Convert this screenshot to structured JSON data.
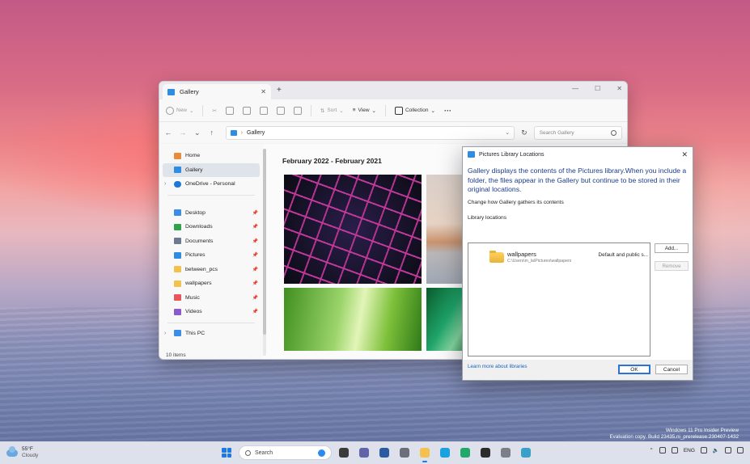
{
  "explorer": {
    "tab_title": "Gallery",
    "toolbar": {
      "new": "New",
      "sort": "Sort",
      "view": "View",
      "collection": "Collection",
      "more": "···"
    },
    "address": "Gallery",
    "search_placeholder": "Search Gallery",
    "sidebar": {
      "top": [
        {
          "label": "Home",
          "icon": "home-icon"
        },
        {
          "label": "Gallery",
          "icon": "gallery-icon",
          "selected": true
        },
        {
          "label": "OneDrive - Personal",
          "icon": "cloud-icon",
          "expandable": true
        }
      ],
      "pinned": [
        {
          "label": "Desktop",
          "icon": "desktop-icon",
          "color": "#3a8ee6"
        },
        {
          "label": "Downloads",
          "icon": "download-icon",
          "color": "#2fa24b"
        },
        {
          "label": "Documents",
          "icon": "documents-icon",
          "color": "#6b7a8f"
        },
        {
          "label": "Pictures",
          "icon": "pictures-icon",
          "color": "#2e8de0"
        },
        {
          "label": "between_pcs",
          "icon": "folder-icon",
          "color": "#f2c14e"
        },
        {
          "label": "wallpapers",
          "icon": "folder-icon",
          "color": "#f2c14e"
        },
        {
          "label": "Music",
          "icon": "music-icon",
          "color": "#e8555a"
        },
        {
          "label": "Videos",
          "icon": "videos-icon",
          "color": "#8b5cc9"
        }
      ],
      "this_pc": "This PC"
    },
    "status": "10 items",
    "gallery_heading": "February 2022 - February 2021"
  },
  "dialog": {
    "title": "Pictures Library Locations",
    "description": "Gallery displays the contents of the Pictures library.When you include a folder, the files appear in the Gallery but continue to be stored in their original locations.",
    "sub": "Change how Gallery gathers its contents",
    "list_label": "Library locations",
    "location": {
      "name": "wallpapers",
      "path": "C:\\Users\\m_la\\Pictures\\wallpapers",
      "default": "Default and public s..."
    },
    "add": "Add...",
    "remove": "Remove",
    "learn_more": "Learn more about libraries",
    "ok": "OK",
    "cancel": "Cancel"
  },
  "eval": {
    "line1": "Windows 11 Pro Insider Preview",
    "line2": "Evaluation copy. Build 23435.ni_prerelease.230407-1432"
  },
  "taskbar": {
    "temp": "55°F",
    "condition": "Cloudy",
    "search": "Search",
    "apps": [
      {
        "name": "task-view",
        "color": "#3b3b3b"
      },
      {
        "name": "chat",
        "color": "#6264a7"
      },
      {
        "name": "widgets",
        "color": "#2c5aa0"
      },
      {
        "name": "settings",
        "color": "#6b6f7a"
      },
      {
        "name": "file-explorer",
        "color": "#f2c14e",
        "active": true
      },
      {
        "name": "edge",
        "color": "#1aa1e0"
      },
      {
        "name": "edge-canary",
        "color": "#23a86b"
      },
      {
        "name": "terminal",
        "color": "#2b2b2b"
      },
      {
        "name": "snipping-tool",
        "color": "#7a7f8a"
      },
      {
        "name": "notepad",
        "color": "#3aa0c8"
      }
    ],
    "lang": "ENG"
  }
}
